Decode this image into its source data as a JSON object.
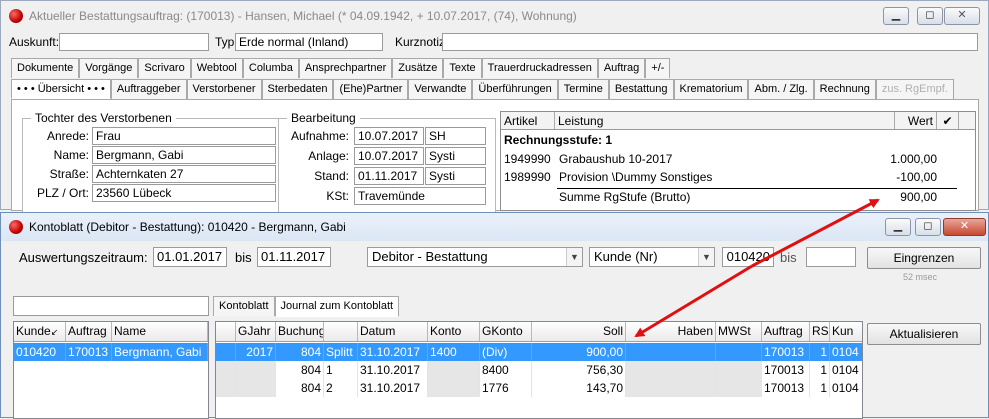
{
  "main_window": {
    "title": "Aktueller Bestattungsauftrag: (170013) - Hansen, Michael (* 04.09.1942, + 10.07.2017, (74), Wohnung)",
    "auskunft_label": "Auskunft:",
    "auskunft_value": "",
    "typ_label": "Typ:",
    "typ_value": "Erde normal (Inland)",
    "kurznotiz_label": "Kurznotiz:",
    "kurznotiz_value": "",
    "tabs_row1": [
      "Dokumente",
      "Vorgänge",
      "Scrivaro",
      "Webtool",
      "Columba",
      "Ansprechpartner",
      "Zusätze",
      "Texte",
      "Trauerdruckadressen",
      "Auftrag",
      "+/-"
    ],
    "tabs_row2": [
      "• • •  Übersicht  • • •",
      "Auftraggeber",
      "Verstorbener",
      "Sterbedaten",
      "(Ehe)Partner",
      "Verwandte",
      "Überführungen",
      "Termine",
      "Bestattung",
      "Krematorium",
      "Abm. / Zlg.",
      "Rechnung",
      "zus. RgEmpf."
    ],
    "deceased_group": {
      "title": "Tochter des Verstorbenen",
      "fields": [
        {
          "label": "Anrede:",
          "value": "Frau"
        },
        {
          "label": "Name:",
          "value": "Bergmann, Gabi"
        },
        {
          "label": "Straße:",
          "value": "Achternkaten 27"
        },
        {
          "label": "PLZ / Ort:",
          "value": "23560 Lübeck"
        }
      ]
    },
    "processing_group": {
      "title": "Bearbeitung",
      "fields": [
        {
          "label": "Aufnahme:",
          "date": "10.07.2017",
          "user": "SH"
        },
        {
          "label": "Anlage:",
          "date": "10.07.2017",
          "user": "Systi"
        },
        {
          "label": "Stand:",
          "date": "01.11.2017",
          "user": "Systi"
        }
      ],
      "kst_label": "KSt:",
      "kst_value": "Travemünde"
    },
    "invoice": {
      "headers": [
        "Artikel",
        "Leistung",
        "Wert",
        "✔"
      ],
      "stage_label": "Rechnungsstufe:  1",
      "rows": [
        {
          "artikel": "1949990",
          "leistung": "Grabaushub 10-2017",
          "wert": "1.000,00"
        },
        {
          "artikel": "1989990",
          "leistung": "Provision \\Dummy Sonstiges",
          "wert": "-100,00"
        }
      ],
      "sum_label": "Summe RgStufe (Brutto)",
      "sum_value": "900,00"
    }
  },
  "account_window": {
    "title": "Kontoblatt (Debitor - Bestattung): 010420 - Bergmann, Gabi",
    "range_label": "Auswertungszeitraum:",
    "date_from": "01.01.2017",
    "bis_label": "bis",
    "date_to": "01.11.2017",
    "account_type": "Debitor - Bestattung",
    "sort_by": "Kunde (Nr)",
    "account_from": "010420",
    "bis_label2": "bis",
    "account_to": "",
    "btn_filter": "Eingrenzen",
    "filter_time": "52 msec",
    "btn_refresh": "Aktualisieren",
    "search_value": "",
    "tabs": [
      "Kontoblatt",
      "Journal zum Kontoblatt"
    ],
    "customer_headers": [
      "Kunde",
      "Auftrag",
      "Name"
    ],
    "customers": [
      {
        "kunde": "010420",
        "auftrag": "170013",
        "name": "Bergmann, Gabi"
      }
    ],
    "journal_headers": [
      "",
      "GJahr",
      "Buchung",
      "",
      "Datum",
      "Konto",
      "GKonto",
      "Soll",
      "Haben",
      "MWSt",
      "Auftrag",
      "RS",
      "Kun"
    ],
    "journal_rows": [
      {
        "gjahr": "2017",
        "buchung": "804",
        "sub": "Splitt",
        "datum": "31.10.2017",
        "konto": "1400",
        "gkonto": "(Div)",
        "soll": "900,00",
        "haben": "",
        "mwst": "",
        "auftrag": "170013",
        "rs": "1",
        "kun": "0104"
      },
      {
        "gjahr": "",
        "buchung": "804",
        "sub": "1",
        "datum": "31.10.2017",
        "konto": "",
        "gkonto": "8400",
        "soll": "756,30",
        "haben": "",
        "mwst": "",
        "auftrag": "170013",
        "rs": "1",
        "kun": "0104"
      },
      {
        "gjahr": "",
        "buchung": "804",
        "sub": "2",
        "datum": "31.10.2017",
        "konto": "",
        "gkonto": "1776",
        "soll": "143,70",
        "haben": "",
        "mwst": "",
        "auftrag": "170013",
        "rs": "1",
        "kun": "0104"
      }
    ]
  },
  "colors": {
    "selection": "#3399ff",
    "annotation_arrow": "#e01010"
  }
}
